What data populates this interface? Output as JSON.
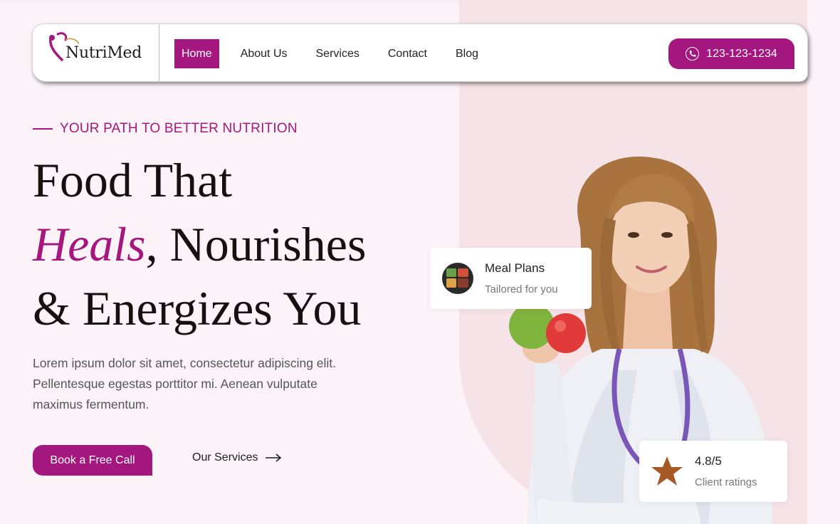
{
  "brand": {
    "name": "NutriMed",
    "accent": "#a3177f"
  },
  "nav": {
    "items": [
      {
        "label": "Home",
        "active": true
      },
      {
        "label": "About Us",
        "active": false
      },
      {
        "label": "Services",
        "active": false
      },
      {
        "label": "Contact",
        "active": false
      },
      {
        "label": "Blog",
        "active": false
      }
    ]
  },
  "phone": {
    "number": "123-123-1234",
    "icon": "phone-icon"
  },
  "hero": {
    "eyebrow": "YOUR PATH TO BETTER NUTRITION",
    "headline_line1": "Food That",
    "headline_accent": "Heals",
    "headline_line2_rest": ", Nourishes",
    "headline_line3": "& Energizes You",
    "lead": "Lorem ipsum dolor sit amet, consectetur adipiscing elit. Pellentesque egestas porttitor mi. Aenean vulputate maximus fermentum.",
    "cta_label": "Book a Free Call",
    "secondary_label": "Our Services"
  },
  "cards": {
    "meal": {
      "title": "Meal Plans",
      "subtitle": "Tailored for you"
    },
    "rating": {
      "value": "4.8/5",
      "subtitle": "Client ratings",
      "icon": "star-icon"
    }
  }
}
